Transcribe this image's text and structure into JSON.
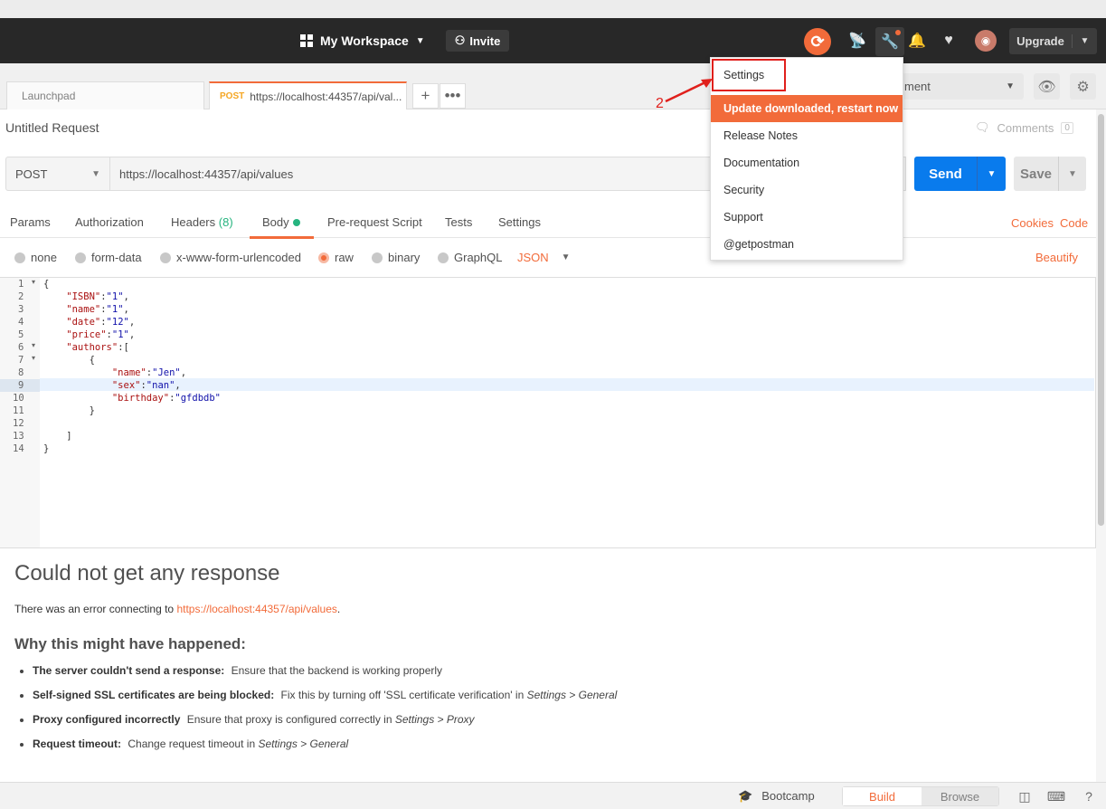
{
  "header": {
    "workspace": "My Workspace",
    "invite": "Invite",
    "upgrade": "Upgrade"
  },
  "tabs": [
    {
      "label": "Launchpad"
    },
    {
      "method": "POST",
      "label": "https://localhost:44357/api/val..."
    }
  ],
  "environment": {
    "label": "ment"
  },
  "request": {
    "title": "Untitled Request",
    "comments": "Comments",
    "comments_count": "0",
    "method": "POST",
    "url": "https://localhost:44357/api/values",
    "send": "Send",
    "save": "Save"
  },
  "request_tabs": {
    "params": "Params",
    "authorization": "Authorization",
    "headers": "Headers",
    "headers_count": "(8)",
    "body": "Body",
    "prerequest": "Pre-request Script",
    "tests": "Tests",
    "settings": "Settings",
    "cookies": "Cookies",
    "code": "Code"
  },
  "body_types": {
    "none": "none",
    "form_data": "form-data",
    "urlencoded": "x-www-form-urlencoded",
    "raw": "raw",
    "binary": "binary",
    "graphql": "GraphQL",
    "format": "JSON",
    "beautify": "Beautify"
  },
  "code_lines": [
    "1",
    "2",
    "3",
    "4",
    "5",
    "6",
    "7",
    "8",
    "9",
    "10",
    "11",
    "12",
    "13",
    "14"
  ],
  "code": {
    "l1": "{",
    "l2k": "    \"ISBN\"",
    "l2v": "\"1\"",
    "l3k": "    \"name\"",
    "l3v": "\"1\"",
    "l4k": "    \"date\"",
    "l4v": "\"12\"",
    "l5k": "    \"price\"",
    "l5v": "\"1\"",
    "l6k": "    \"authors\"",
    "l6v": "[",
    "l7": "        {",
    "l8k": "            \"name\"",
    "l8v": "\"Jen\"",
    "l9k": "            \"sex\"",
    "l9v": "\"nan\"",
    "l10k": "            \"birthday\"",
    "l10v": "\"gfdbdb\"",
    "l11": "        }",
    "l12": "",
    "l13": "    ]",
    "l14": "}"
  },
  "response": {
    "title": "Could not get any response",
    "error_prefix": "There was an error connecting to ",
    "error_url": "https://localhost:44357/api/values",
    "error_suffix": ".",
    "why_title": "Why this might have happened:",
    "reasons": [
      {
        "bold": "The server couldn't send a response:",
        "text": "Ensure that the backend is working properly",
        "italic": ""
      },
      {
        "bold": "Self-signed SSL certificates are being blocked:",
        "text": "Fix this by turning off 'SSL certificate verification' in ",
        "italic": "Settings > General"
      },
      {
        "bold": "Proxy configured incorrectly",
        "text": "Ensure that proxy is configured correctly in ",
        "italic": "Settings > Proxy"
      },
      {
        "bold": "Request timeout:",
        "text": "Change request timeout in ",
        "italic": "Settings > General"
      }
    ]
  },
  "footer": {
    "bootcamp": "Bootcamp",
    "build": "Build",
    "browse": "Browse"
  },
  "menu": {
    "settings": "Settings",
    "update": "Update downloaded, restart now",
    "release_notes": "Release Notes",
    "documentation": "Documentation",
    "security": "Security",
    "support": "Support",
    "getpostman": "@getpostman"
  },
  "annotation": {
    "number": "2"
  },
  "colors": {
    "accent": "#f26b3a",
    "send": "#097bed",
    "header_bg": "#282828",
    "highlight_red": "#e0201c"
  }
}
